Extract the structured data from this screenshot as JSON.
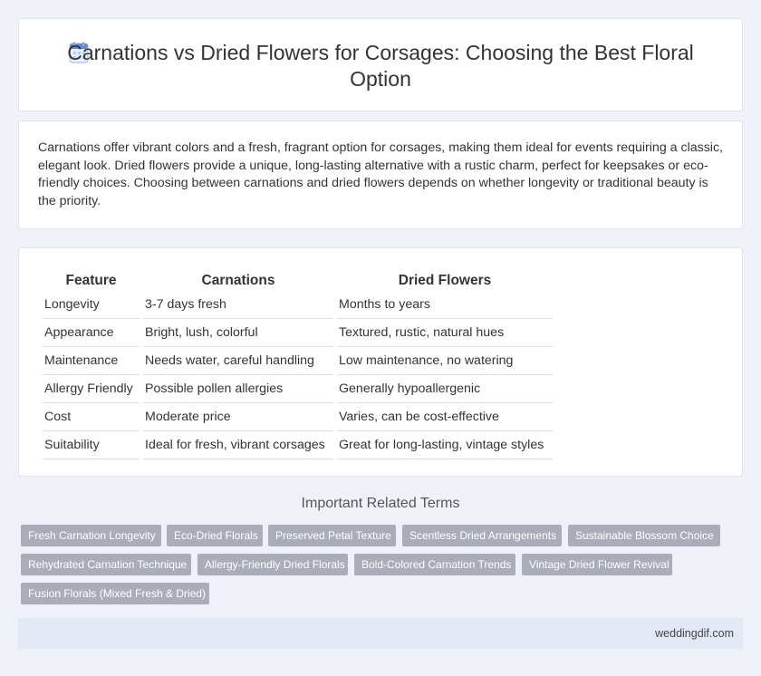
{
  "header": {
    "title": "Carnations vs Dried Flowers for Corsages: Choosing the Best Floral Option",
    "icon": "document-icon"
  },
  "intro": {
    "text": "Carnations offer vibrant colors and a fresh, fragrant option for corsages, making them ideal for events requiring a classic, elegant look. Dried flowers provide a unique, long-lasting alternative with a rustic charm, perfect for keepsakes or eco-friendly choices. Choosing between carnations and dried flowers depends on whether longevity or traditional beauty is the priority."
  },
  "comparison": {
    "headers": [
      "Feature",
      "Carnations",
      "Dried Flowers"
    ],
    "rows": [
      [
        "Longevity",
        "3-7 days fresh",
        "Months to years"
      ],
      [
        "Appearance",
        "Bright, lush, colorful",
        "Textured, rustic, natural hues"
      ],
      [
        "Maintenance",
        "Needs water, careful handling",
        "Low maintenance, no watering"
      ],
      [
        "Allergy Friendly",
        "Possible pollen allergies",
        "Generally hypoallergenic"
      ],
      [
        "Cost",
        "Moderate price",
        "Varies, can be cost-effective"
      ],
      [
        "Suitability",
        "Ideal for fresh, vibrant corsages",
        "Great for long-lasting, vintage styles"
      ]
    ]
  },
  "related": {
    "heading": "Important Related Terms",
    "tags": [
      "Fresh Carnation Longevity",
      "Eco-Dried Florals",
      "Preserved Petal Texture",
      "Scentless Dried Arrangements",
      "Sustainable Blossom Choice",
      "Rehydrated Carnation Technique",
      "Allergy-Friendly Dried Florals",
      "Bold-Colored Carnation Trends",
      "Vintage Dried Flower Revival",
      "Fusion Florals (Mixed Fresh & Dried)"
    ]
  },
  "footer": {
    "site": "weddingdif.com"
  },
  "colors": {
    "background": "#eef1f7",
    "tag": "#a8adb7",
    "footer": "#e3e9f4",
    "icon_accent": "#5b8def"
  }
}
